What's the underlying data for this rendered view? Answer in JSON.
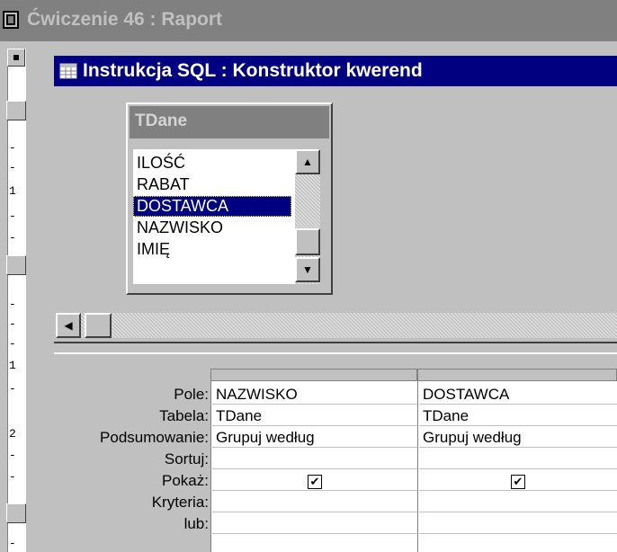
{
  "outer_window": {
    "title": "Ćwiczenie 46 : Raport"
  },
  "inner_window": {
    "title": "Instrukcja SQL : Konstruktor kwerend"
  },
  "table_box": {
    "name": "TDane",
    "fields": [
      "ILOŚĆ",
      "RABAT",
      "DOSTAWCA",
      "NAZWISKO",
      "IMIĘ"
    ],
    "selected": "DOSTAWCA"
  },
  "report_ruler": {
    "ticks": [
      "-",
      "-",
      "1",
      "-",
      "-",
      "-",
      "-",
      "-",
      "1",
      "-",
      "2",
      "-",
      "-",
      "-"
    ]
  },
  "design_grid": {
    "row_labels": {
      "pole": "Pole:",
      "tabela": "Tabela:",
      "podsumowanie": "Podsumowanie:",
      "sortuj": "Sortuj:",
      "pokaz": "Pokaż:",
      "kryteria": "Kryteria:",
      "lub": "lub:"
    },
    "columns": [
      {
        "pole": "NAZWISKO",
        "tabela": "TDane",
        "podsumowanie": "Grupuj według",
        "sortuj": "",
        "pokaz": true,
        "kryteria": "",
        "lub": ""
      },
      {
        "pole": "DOSTAWCA",
        "tabela": "TDane",
        "podsumowanie": "Grupuj według",
        "sortuj": "",
        "pokaz": true,
        "kryteria": "",
        "lub": ""
      }
    ]
  },
  "icons": {
    "checkbox_checked": "✔",
    "scroll_up": "▲",
    "scroll_down": "▼",
    "scroll_left": "◀"
  }
}
